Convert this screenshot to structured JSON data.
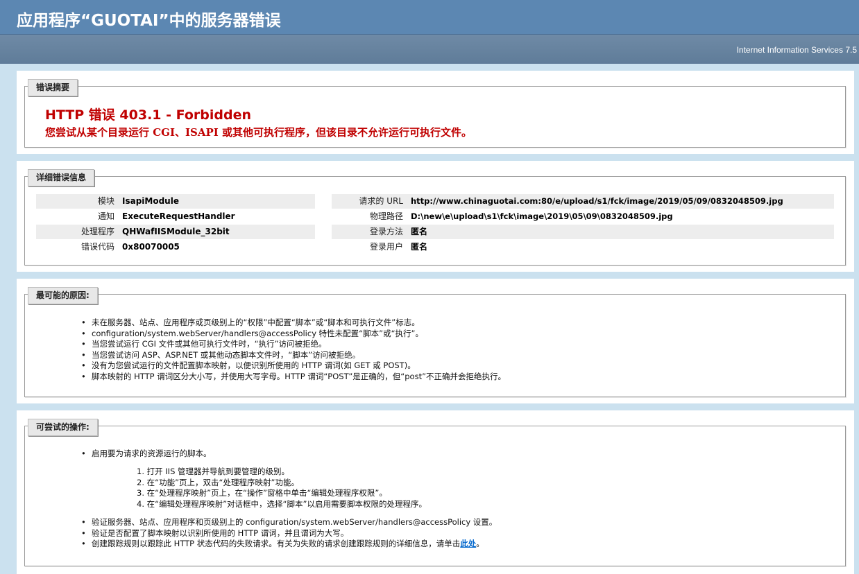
{
  "header": {
    "title": "应用程序“GUOTAI”中的服务器错误",
    "server": "Internet Information Services 7.5"
  },
  "summary": {
    "legend": "错误摘要",
    "title": "HTTP 错误 403.1 - Forbidden",
    "description": "您尝试从某个目录运行 CGI、ISAPI 或其他可执行程序，但该目录不允许运行可执行文件。"
  },
  "details": {
    "legend": "详细错误信息",
    "left": [
      {
        "label": "模块",
        "value": "IsapiModule"
      },
      {
        "label": "通知",
        "value": "ExecuteRequestHandler"
      },
      {
        "label": "处理程序",
        "value": "QHWafIISModule_32bit"
      },
      {
        "label": "错误代码",
        "value": "0x80070005"
      }
    ],
    "right": [
      {
        "label": "请求的 URL",
        "value": "http://www.chinaguotai.com:80/e/upload/s1/fck/image/2019/05/09/0832048509.jpg"
      },
      {
        "label": "物理路径",
        "value": "D:\\new\\e\\upload\\s1\\fck\\image\\2019\\05\\09\\0832048509.jpg"
      },
      {
        "label": "登录方法",
        "value": "匿名"
      },
      {
        "label": "登录用户",
        "value": "匿名"
      }
    ]
  },
  "causes": {
    "legend": "最可能的原因:",
    "items": [
      "未在服务器、站点、应用程序或页级别上的“权限”中配置“脚本”或“脚本和可执行文件”标志。",
      "configuration/system.webServer/handlers@accessPolicy 特性未配置“脚本”或“执行”。",
      "当您尝试运行 CGI 文件或其他可执行文件时，“执行”访问被拒绝。",
      "当您尝试访问 ASP、ASP.NET 或其他动态脚本文件时，“脚本”访问被拒绝。",
      "没有为您尝试运行的文件配置脚本映射，以便识别所使用的 HTTP 谓词(如 GET 或 POST)。",
      "脚本映射的 HTTP 谓词区分大小写，并使用大写字母。HTTP 谓词“POST”是正确的，但“post”不正确并会拒绝执行。"
    ]
  },
  "actions": {
    "legend": "可尝试的操作:",
    "first": "启用要为请求的资源运行的脚本。",
    "steps": [
      "1. 打开 IIS 管理器并导航到要管理的级别。",
      "2. 在“功能”页上，双击“处理程序映射”功能。",
      "3. 在“处理程序映射”页上，在“操作”窗格中单击“编辑处理程序权限”。",
      "4. 在“编辑处理程序映射”对话框中，选择“脚本”以启用需要脚本权限的处理程序。"
    ],
    "more": [
      "验证服务器、站点、应用程序和页级别上的 configuration/system.webServer/handlers@accessPolicy 设置。",
      "验证是否配置了脚本映射以识别所使用的 HTTP 谓词，并且谓词为大写。"
    ],
    "last_prefix": "创建跟踪规则以跟踪此 HTTP 状态代码的失败请求。有关为失败的请求创建跟踪规则的详细信息，请单击",
    "last_link": "此处",
    "last_suffix": "。"
  }
}
